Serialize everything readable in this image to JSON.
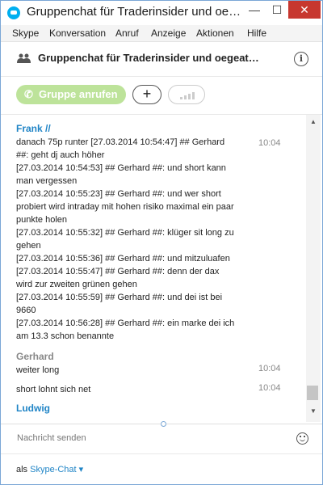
{
  "window": {
    "title": "Gruppenchat für Traderinsider und oe…"
  },
  "window_controls": {
    "minimize": "—",
    "maximize": "☐",
    "close": "✕"
  },
  "menu": [
    "Skype",
    "Konversation",
    "Anruf",
    "Anzeige",
    "Aktionen",
    "Hilfe"
  ],
  "conversation": {
    "title": "Gruppenchat für Traderinsider und oegeat…",
    "info_label": "i"
  },
  "actions": {
    "call_label": "Gruppe anrufen",
    "add_label": "+"
  },
  "messages": [
    {
      "sender": "Frank //",
      "time": "10:04",
      "lines": [
        "danach 75p runter [27.03.2014 10:54:47] ## Gerhard",
        "##: geht dj auch höher",
        "[27.03.2014 10:54:53] ## Gerhard ##: und short kann",
        "man vergessen",
        "[27.03.2014 10:55:23] ## Gerhard ##: und wer short",
        "probiert  wird intraday mit hohen risiko maximal ein paar",
        "punkte holen",
        "[27.03.2014 10:55:32] ## Gerhard ##: klüger sit long zu",
        "gehen",
        "[27.03.2014 10:55:36] ## Gerhard ##: und mitzuluafen",
        "[27.03.2014 10:55:47] ## Gerhard ##: denn der dax",
        "wird zur zweiten grünen gehen",
        "[27.03.2014 10:55:59] ## Gerhard ##: und dei ist bei",
        "9660",
        "[27.03.2014 10:56:28] ## Gerhard ##: ein marke dei ich",
        "am 13.3 schon benannte"
      ]
    },
    {
      "sender": "Gerhard",
      "items": [
        {
          "text": "weiter long",
          "time": "10:04"
        },
        {
          "text": "short lohnt sich net",
          "time": "10:04"
        }
      ]
    },
    {
      "sender": "Ludwig"
    }
  ],
  "input": {
    "placeholder": "Nachricht senden"
  },
  "footer": {
    "prefix": "als",
    "account": "Skype-Chat ▾"
  }
}
